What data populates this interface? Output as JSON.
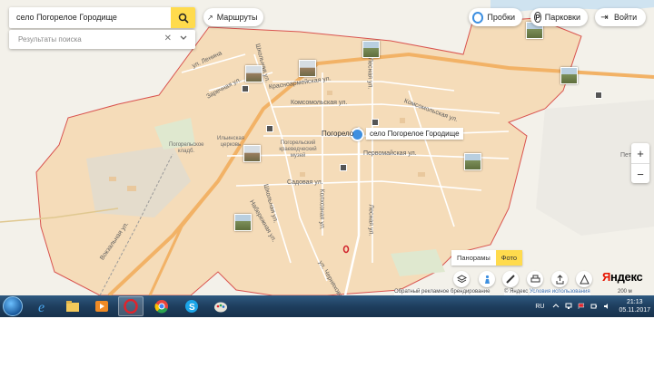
{
  "search": {
    "query": "село Погорелое Городище",
    "results_placeholder": "Результаты поиска"
  },
  "top_buttons": {
    "routes": "Маршруты",
    "traffic": "Пробки",
    "parking": "Парковки",
    "login": "Войти"
  },
  "place": {
    "label": "село Погорелое Городище",
    "town_partial": "Погорело"
  },
  "streets": {
    "lenina": "ул. Ленина",
    "zarechnaya": "Заречная ул.",
    "krasnoarmeyskaya": "Красноармейская ул.",
    "komsomolskaya": "Комсомольская ул.",
    "komsomolskaya2": "Комсомольская ул.",
    "lesnaya": "Лесная ул.",
    "shkolnaya": "Школьная ул.",
    "shkolnaya2": "Школьная ул.",
    "pervomayskaya": "Первомайская ул.",
    "sadovaya": "Садовая ул.",
    "naberezhnaya": "Набережная ул.",
    "kolkhoznaya": "Колхозная ул.",
    "lesnaya2": "Лесная ул.",
    "vokzalnaya": "Вокзальная ул.",
    "chernyakhova": "ул. Черняхова"
  },
  "pois": {
    "cemetery": "Погорельское кладб.",
    "church": "Ильинская церковь",
    "museum": "Погорельский краеведческий музей",
    "right_edge": "Пет"
  },
  "photo_tabs": {
    "panoramas": "Панорамы",
    "photo": "Фото"
  },
  "map_footer": {
    "ad": "Обратный рекламное брендирование",
    "copyright": "© Яндекс",
    "terms": "Условия использования",
    "scale": "200 м",
    "logo_first": "Я",
    "logo_rest": "ндекс"
  },
  "zoom": {
    "in": "+",
    "out": "−"
  },
  "taskbar": {
    "apps": [
      "start-orb",
      "internet-explorer",
      "file-explorer",
      "media-player",
      "opera",
      "chrome",
      "skype",
      "paint"
    ],
    "language": "RU",
    "time": "21:13",
    "date": "05.11.2017"
  },
  "colors": {
    "accent": "#ffdb4d",
    "settlement_fill": "#f5dcb9",
    "boundary": "#d9534f",
    "road_main": "#f2b266",
    "pin": "#3d8fe0"
  }
}
